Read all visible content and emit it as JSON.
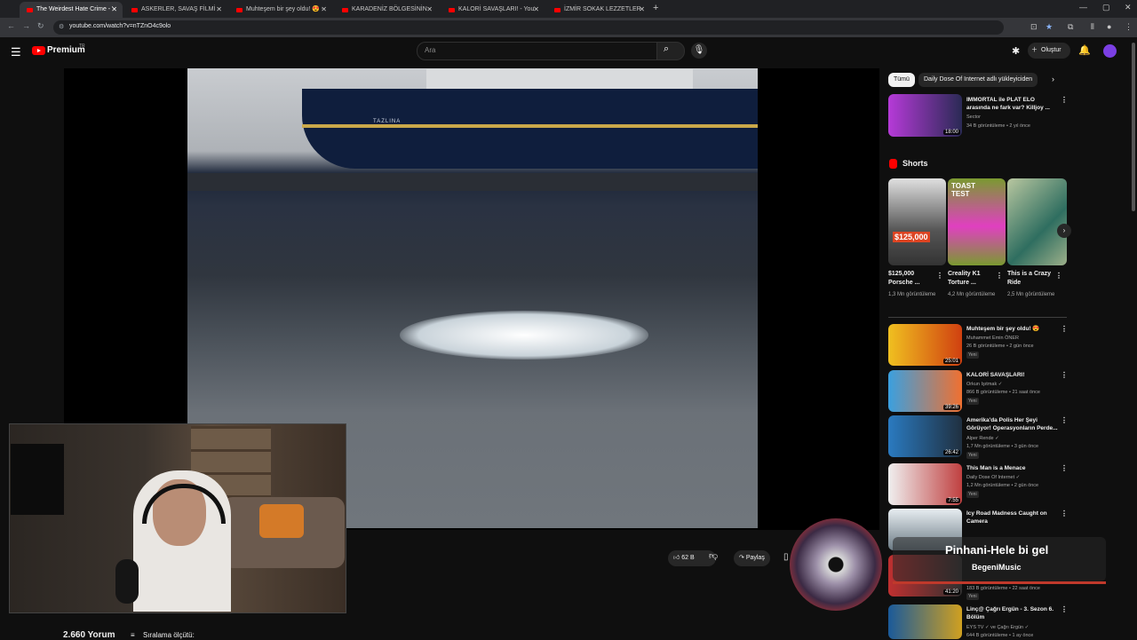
{
  "browser": {
    "tabs": [
      {
        "title": "The Weirdest Hate Crime - You",
        "active": true
      },
      {
        "title": "ASKERLER, SAVAŞ FİLMİ SAHNE",
        "active": false
      },
      {
        "title": "Muhteşem bir şey oldu! 😍 - Yo",
        "active": false
      },
      {
        "title": "KARADENİZ BÖLGESİNİN EN Ç",
        "active": false
      },
      {
        "title": "KALORİ SAVAŞLARI! - YouTube",
        "active": false
      },
      {
        "title": "İZMİR SOKAK LEZZETLERİ - You",
        "active": false
      }
    ],
    "new_tab": "+",
    "url": "youtube.com/watch?v=nTZnO4c9olo"
  },
  "header": {
    "brand": "Premium",
    "region": "TR",
    "search_placeholder": "Ara",
    "create_label": "Oluştur"
  },
  "video": {
    "ship_name": "TAZLINA",
    "likes": "62 B",
    "share_label": "Paylaş"
  },
  "comments": {
    "count_label": "2.660 Yorum",
    "sort_label": "Sıralama ölçütü:"
  },
  "sidebar": {
    "chips": [
      "Tümü",
      "Daily Dose Of Internet adlı yükleyiciden"
    ],
    "top_video": {
      "title": "IMMORTAL ile PLAT ELO arasında ne fark var? Killjoy ...",
      "channel": "Sector",
      "meta": "34 B görüntüleme • 2 yıl önce",
      "duration": "18:00"
    },
    "shorts_title": "Shorts",
    "shorts": [
      {
        "title": "$125,000 Porsche ...",
        "views": "1,3 Mn görüntüleme",
        "overlay": "$125,000"
      },
      {
        "title": "Creality K1 Torture ...",
        "views": "4,2 Mn görüntüleme",
        "overlay": "TOAST TEST"
      },
      {
        "title": "This is a Crazy Ride",
        "views": "2,5 Mn görüntüleme",
        "overlay": ""
      }
    ],
    "videos": [
      {
        "title": "Muhteşem bir şey oldu! 😍",
        "channel": "Muhammet Emin ÖNER",
        "meta": "26 B görüntüleme • 2 gün önce",
        "badge": "Yeni",
        "duration": "25:01"
      },
      {
        "title": "KALORİ SAVAŞLARI!",
        "channel": "Orkun Işıtmak ✓",
        "meta": "866 B görüntüleme • 21 saat önce",
        "badge": "Yeni",
        "duration": "39:26"
      },
      {
        "title": "Amerika'da Polis Her Şeyi Görüyor! Operasyonların Perde...",
        "channel": "Alper Rende ✓",
        "meta": "1,7 Mn görüntüleme • 3 gün önce",
        "badge": "Yeni",
        "duration": "26:42"
      },
      {
        "title": "This Man is a Menace",
        "channel": "Daily Dose Of Internet ✓",
        "meta": "1,2 Mn görüntüleme • 2 gün önce",
        "badge": "Yeni",
        "duration": "7:55"
      },
      {
        "title": "Icy Road Madness Caught on Camera",
        "channel": "",
        "meta": "",
        "badge": "",
        "duration": ""
      },
      {
        "title": "",
        "channel": "",
        "meta": "183 B görüntüleme • 22 saat önce",
        "badge": "Yeni",
        "duration": "41:20"
      },
      {
        "title": "Linç@ Çağrı Ergün - 3. Sezon 6. Bölüm",
        "channel": "EYS TV ✓ ve Çağrı Ergün ✓",
        "meta": "644 B görüntüleme • 1 ay önce",
        "badge": "",
        "duration": ""
      }
    ]
  },
  "now_playing": {
    "song": "Pinhani-Hele bi gel",
    "artist": "BegeniMusic"
  }
}
